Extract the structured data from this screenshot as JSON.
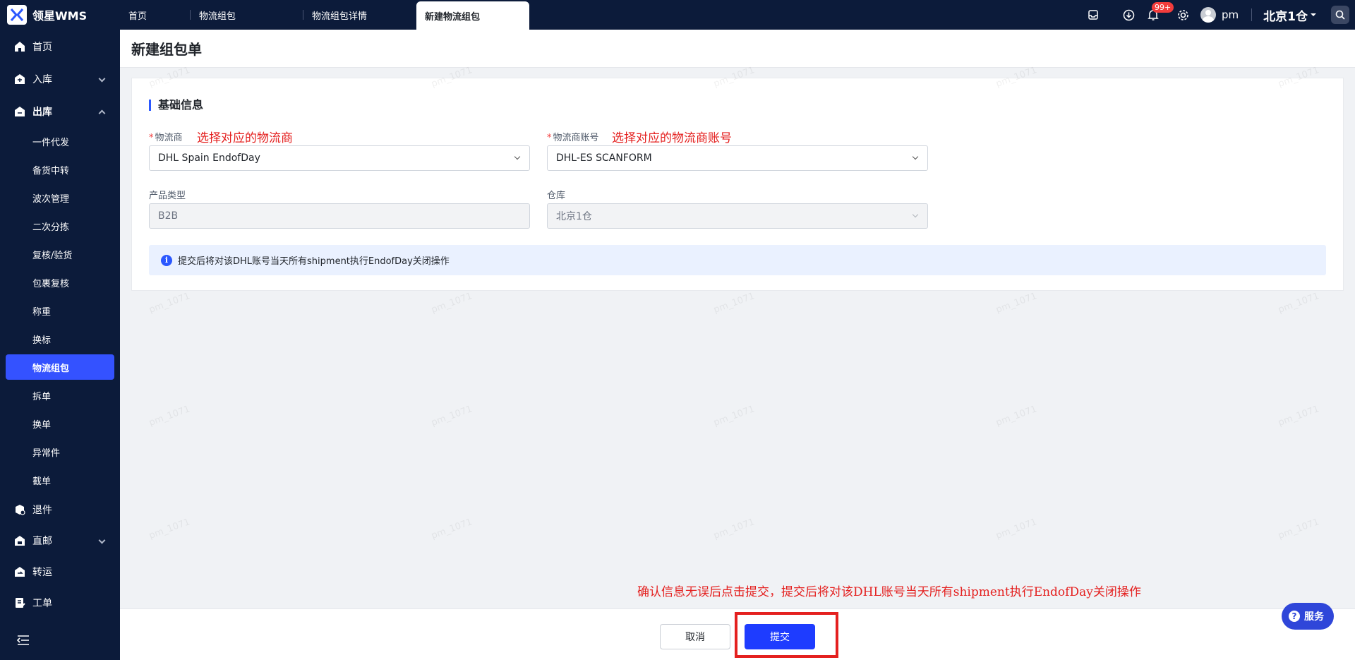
{
  "app": {
    "logo_text": "领星WMS"
  },
  "tabs": [
    {
      "label": "首页"
    },
    {
      "label": "物流组包"
    },
    {
      "label": "物流组包详情"
    },
    {
      "label": "新建物流组包"
    }
  ],
  "header": {
    "notifications_badge": "99+",
    "username": "pm",
    "warehouse": "北京1仓"
  },
  "sidebar": {
    "home": "首页",
    "inbound": "入库",
    "outbound": "出库",
    "outbound_items": [
      "一件代发",
      "备货中转",
      "波次管理",
      "二次分拣",
      "复核/验货",
      "包裹复核",
      "称重",
      "换标",
      "物流组包",
      "拆单",
      "换单",
      "异常件",
      "截单"
    ],
    "returns": "退件",
    "direct": "直邮",
    "transfer": "转运",
    "ticket": "工单"
  },
  "page": {
    "title": "新建组包单"
  },
  "form": {
    "section_title": "基础信息",
    "carrier_label": "物流商",
    "carrier_value": "DHL Spain EndofDay",
    "carrier_annotation": "选择对应的物流商",
    "account_label": "物流商账号",
    "account_value": "DHL-ES SCANFORM",
    "account_annotation": "选择对应的物流商账号",
    "product_type_label": "产品类型",
    "product_type_value": "B2B",
    "warehouse_label": "仓库",
    "warehouse_value": "北京1仓",
    "info_text": "提交后将对该DHL账号当天所有shipment执行EndofDay关闭操作"
  },
  "footer": {
    "cancel_label": "取消",
    "submit_label": "提交",
    "annotation": "确认信息无误后点击提交，提交后将对该DHL账号当天所有shipment执行EndofDay关闭操作"
  },
  "service_label": "服务",
  "watermark": "pm_1071",
  "colors": {
    "nav_bg": "#0c1b3a",
    "accent": "#2b58ff",
    "annotation": "#e4201f",
    "submit": "#1e3cff"
  }
}
